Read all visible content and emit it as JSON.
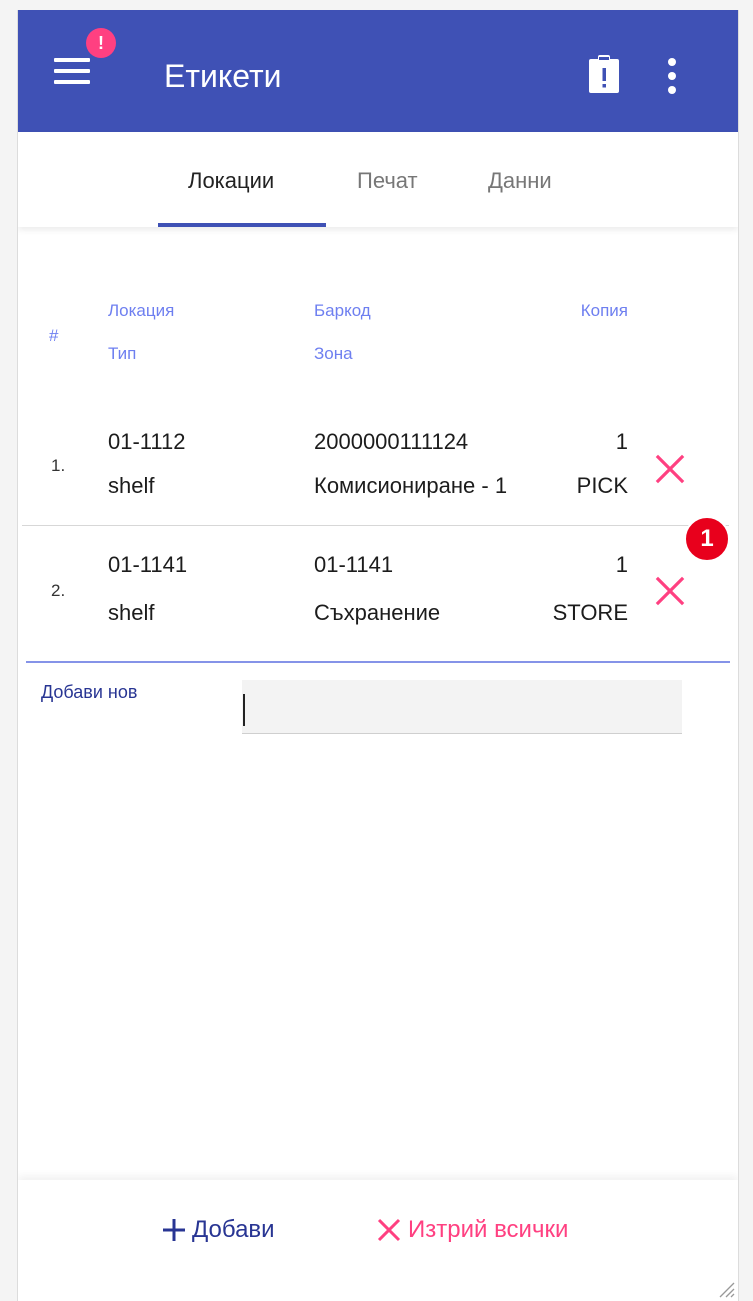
{
  "colors": {
    "primary": "#3f51b5",
    "accent": "#ff4081",
    "header_text": "#6e7ff0",
    "danger": "#e8001c"
  },
  "header": {
    "title": "Етикети",
    "notification_badge": "!",
    "icons": [
      "menu-icon",
      "clipboard-alert-icon",
      "more-vert-icon"
    ]
  },
  "tabs": [
    {
      "label": "Локации",
      "active": true
    },
    {
      "label": "Печат",
      "active": false
    },
    {
      "label": "Данни",
      "active": false
    }
  ],
  "table": {
    "headers": {
      "index": "#",
      "location": "Локация",
      "type": "Тип",
      "barcode": "Баркод",
      "zone": "Зона",
      "copies": "Копия"
    },
    "rows": [
      {
        "index": "1.",
        "location": "01-1112",
        "type": "shelf",
        "barcode": "2000000111124",
        "zone": "Комисиониране - 1",
        "copies": "1",
        "zone_code": "PICK"
      },
      {
        "index": "2.",
        "location": "01-1141",
        "type": "shelf",
        "barcode": "01-1141",
        "zone": "Съхранение",
        "copies": "1",
        "zone_code": "STORE"
      }
    ]
  },
  "marker_badge": "1",
  "add_new": {
    "label": "Добави нов",
    "value": ""
  },
  "footer": {
    "add_label": "Добави",
    "delete_all_label": "Изтрий всички"
  }
}
